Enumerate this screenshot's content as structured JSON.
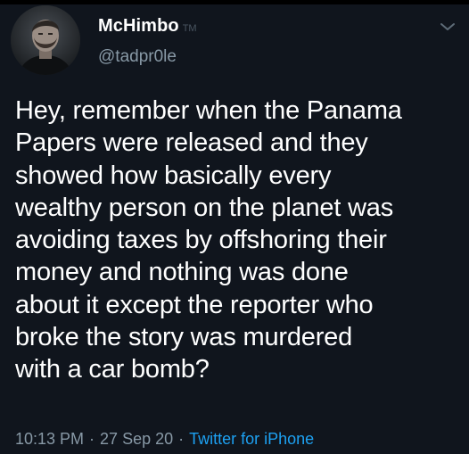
{
  "user": {
    "display_name": "McHimbo",
    "name_suffix": "TM",
    "handle": "@tadpr0le"
  },
  "tweet": {
    "text": "Hey, remember when the Panama\nPapers were released and they\nshowed how basically every\nwealthy person on the planet was\navoiding taxes by offshoring their\nmoney and nothing was done\nabout it except the reporter who\nbroke the story was murdered\nwith a car bomb?",
    "time": "10:13 PM",
    "date": "27 Sep 20",
    "separator": "·",
    "source": "Twitter for iPhone"
  },
  "icons": {
    "menu": "chevron-down-icon"
  },
  "colors": {
    "background": "#10151d",
    "text": "#ffffff",
    "secondary_text": "#8899a6",
    "link": "#1da1f2"
  }
}
